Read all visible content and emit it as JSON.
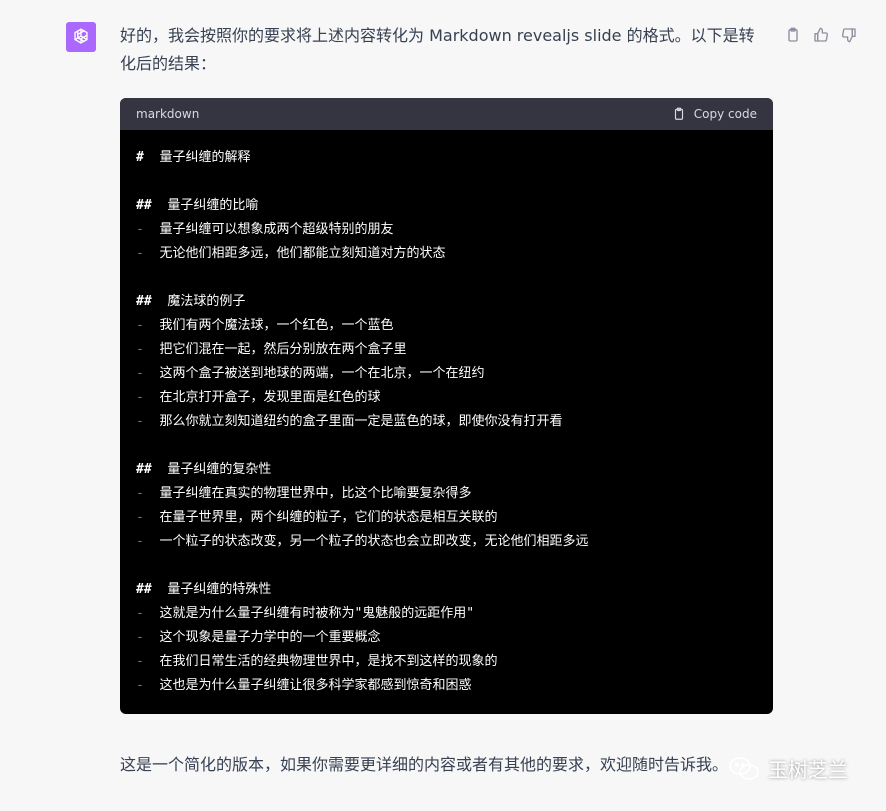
{
  "message": {
    "intro": "好的，我会按照你的要求将上述内容转化为 Markdown revealjs slide 的格式。以下是转化后的结果：",
    "outro": "这是一个简化的版本，如果你需要更详细的内容或者有其他的要求，欢迎随时告诉我。"
  },
  "codeblock": {
    "language": "markdown",
    "copy_label": "Copy code",
    "lines": [
      {
        "marker": "#",
        "text": "量子纠缠的解释"
      },
      {
        "marker": "",
        "text": ""
      },
      {
        "marker": "##",
        "text": "量子纠缠的比喻"
      },
      {
        "marker": "-",
        "text": "量子纠缠可以想象成两个超级特别的朋友"
      },
      {
        "marker": "-",
        "text": "无论他们相距多远，他们都能立刻知道对方的状态"
      },
      {
        "marker": "",
        "text": ""
      },
      {
        "marker": "##",
        "text": "魔法球的例子"
      },
      {
        "marker": "-",
        "text": "我们有两个魔法球，一个红色，一个蓝色"
      },
      {
        "marker": "-",
        "text": "把它们混在一起，然后分别放在两个盒子里"
      },
      {
        "marker": "-",
        "text": "这两个盒子被送到地球的两端，一个在北京，一个在纽约"
      },
      {
        "marker": "-",
        "text": "在北京打开盒子，发现里面是红色的球"
      },
      {
        "marker": "-",
        "text": "那么你就立刻知道纽约的盒子里面一定是蓝色的球，即使你没有打开看"
      },
      {
        "marker": "",
        "text": ""
      },
      {
        "marker": "##",
        "text": "量子纠缠的复杂性"
      },
      {
        "marker": "-",
        "text": "量子纠缠在真实的物理世界中，比这个比喻要复杂得多"
      },
      {
        "marker": "-",
        "text": "在量子世界里，两个纠缠的粒子，它们的状态是相互关联的"
      },
      {
        "marker": "-",
        "text": "一个粒子的状态改变，另一个粒子的状态也会立即改变，无论他们相距多远"
      },
      {
        "marker": "",
        "text": ""
      },
      {
        "marker": "##",
        "text": "量子纠缠的特殊性"
      },
      {
        "marker": "-",
        "text": "这就是为什么量子纠缠有时被称为\"鬼魅般的远距作用\""
      },
      {
        "marker": "-",
        "text": "这个现象是量子力学中的一个重要概念"
      },
      {
        "marker": "-",
        "text": "在我们日常生活的经典物理世界中，是找不到这样的现象的"
      },
      {
        "marker": "-",
        "text": "这也是为什么量子纠缠让很多科学家都感到惊奇和困惑"
      }
    ]
  },
  "watermark": {
    "text": "玉树芝兰"
  },
  "icons": {
    "avatar": "openai-logo-icon",
    "copy": "clipboard-icon",
    "like": "thumbs-up-icon",
    "dislike": "thumbs-down-icon",
    "watermark": "wechat-icon"
  },
  "colors": {
    "avatar_bg": "#ab68ff",
    "code_bg": "#000000",
    "code_header_bg": "#343541",
    "list_marker": "#ef4146",
    "page_bg": "#f7f7f8"
  }
}
